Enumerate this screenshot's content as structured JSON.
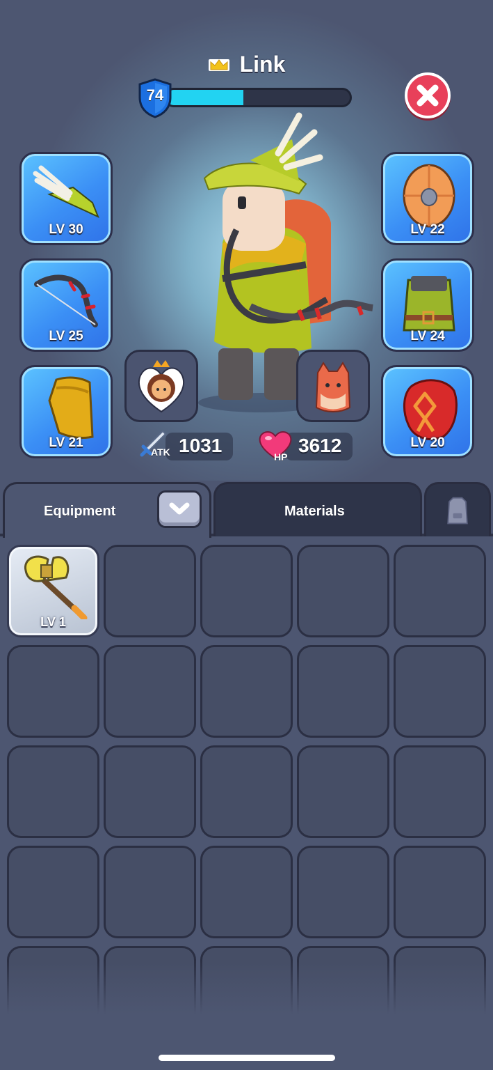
{
  "header": {
    "hero_name": "Link",
    "level": "74",
    "xp_progress": 0.42
  },
  "equipment_slots": {
    "left": [
      {
        "name": "hat",
        "level": "LV 30"
      },
      {
        "name": "bow",
        "level": "LV 25"
      },
      {
        "name": "cape",
        "level": "LV 21"
      }
    ],
    "right": [
      {
        "name": "shield",
        "level": "LV 22"
      },
      {
        "name": "tunic",
        "level": "LV 24"
      },
      {
        "name": "rune",
        "level": "LV 20"
      }
    ]
  },
  "companions": {
    "pet": "pet-avatar-icon",
    "backpack": "fox-backpack-icon"
  },
  "stats": {
    "atk_label": "ATK",
    "atk_value": "1031",
    "hp_label": "HP",
    "hp_value": "3612"
  },
  "tabs": {
    "equipment": "Equipment",
    "materials": "Materials",
    "third_icon": "backpack-icon"
  },
  "inventory": {
    "items": [
      {
        "name": "battle-axe",
        "level": "LV 1"
      }
    ],
    "rows": 5,
    "columns": 5
  },
  "colors": {
    "xp_fill": "#22d3f2",
    "slot_blue": "#3b8ff5",
    "close_red": "#e8405a",
    "background": "#4d5671"
  }
}
